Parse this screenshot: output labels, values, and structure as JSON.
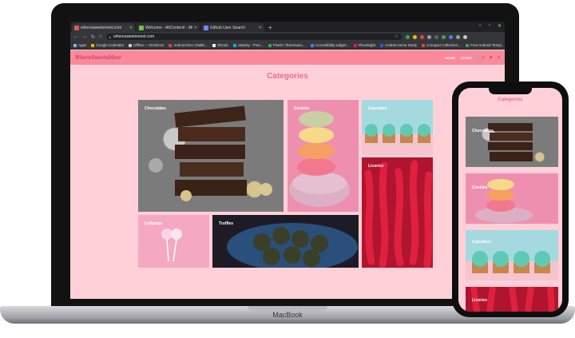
{
  "browser": {
    "tabs": [
      {
        "title": "wheresweetsmeet.com",
        "favicon_color": "#e05a5a",
        "active": true
      },
      {
        "title": "Welcome - AltContent! - Alt...",
        "favicon_color": "#6fbf4a",
        "active": false
      },
      {
        "title": "Github User Search",
        "favicon_color": "#6b8cff",
        "active": false
      }
    ],
    "new_tab_label": "+",
    "url": "wheresweetsmeet.com",
    "window_controls": [
      "–",
      "▫",
      "✕"
    ],
    "bookmarks": [
      {
        "label": "Apps",
        "color": "#8ab4f8"
      },
      {
        "label": "Google Codelabs",
        "color": "#f4b400"
      },
      {
        "label": "Offline — DevDocs",
        "color": "#cfcfcf"
      },
      {
        "label": "Android Dev Challe...",
        "color": "#db4437"
      },
      {
        "label": "GitHub",
        "color": "#ffffff"
      },
      {
        "label": "Udacity - Free...",
        "color": "#02b3e4"
      },
      {
        "label": "Pixel4 / thommaso...",
        "color": "#34a853"
      },
      {
        "label": "Accessibility widget...",
        "color": "#4285f4"
      },
      {
        "label": "Pluralsight",
        "color": "#e80a89"
      },
      {
        "label": "Andela Home Study",
        "color": "#3359df"
      },
      {
        "label": "Compact Collection...",
        "color": "#ea4335"
      },
      {
        "label": "Free Android Templ...",
        "color": "#34a853"
      }
    ],
    "extension_colors": [
      "#34a853",
      "#fbbc05",
      "#ea4335",
      "#9e9e9e",
      "#5f6368",
      "#34a853",
      "#4285f4",
      "#9e9e9e",
      "#c8c8c8"
    ]
  },
  "site": {
    "logo": "WhereSweetsMeet",
    "nav": {
      "home": "HOME",
      "store": "STORE",
      "cart_count": "0"
    },
    "title": "Categories",
    "categories": [
      {
        "label": "Chocolates",
        "image": "chocolate-stack"
      },
      {
        "label": "Cookies",
        "image": "macarons"
      },
      {
        "label": "Cupcakes",
        "image": "cupcakes"
      },
      {
        "label": "Licorice",
        "image": "red-licorice"
      },
      {
        "label": "Lollipops",
        "image": "pink-lollipops"
      },
      {
        "label": "Truffles",
        "image": "truffles-bowl"
      }
    ],
    "accent_color": "#fa8a9a",
    "background_color": "#ffd0d8",
    "title_color": "#e87182"
  },
  "device_labels": {
    "laptop": "MacBook"
  }
}
